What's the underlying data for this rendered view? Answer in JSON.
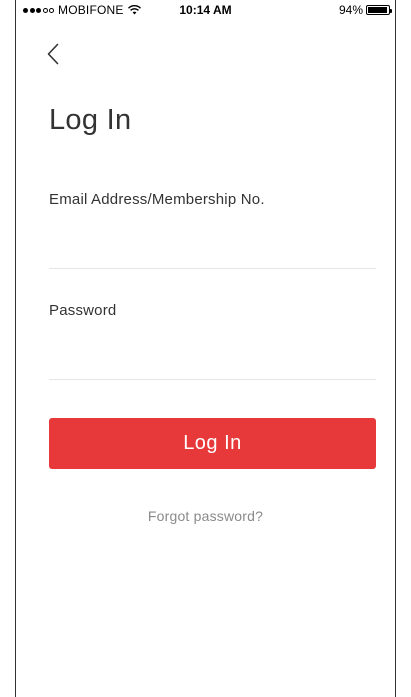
{
  "status_bar": {
    "carrier": "MOBIFONE",
    "time": "10:14 AM",
    "battery": "94%",
    "battery_level": 0.94,
    "signal_bars_filled": 3,
    "signal_bars_total": 5
  },
  "nav": {
    "back_icon": "chevron-left-icon"
  },
  "page": {
    "title": "Log In"
  },
  "form": {
    "email_label": "Email Address/Membership No.",
    "email_value": "",
    "password_label": "Password",
    "password_value": "",
    "submit_label": "Log In",
    "forgot_label": "Forgot password?"
  },
  "colors": {
    "accent": "#e8393a",
    "text": "#333333",
    "muted": "#8a8a8a",
    "divider": "#e6e6e6"
  }
}
